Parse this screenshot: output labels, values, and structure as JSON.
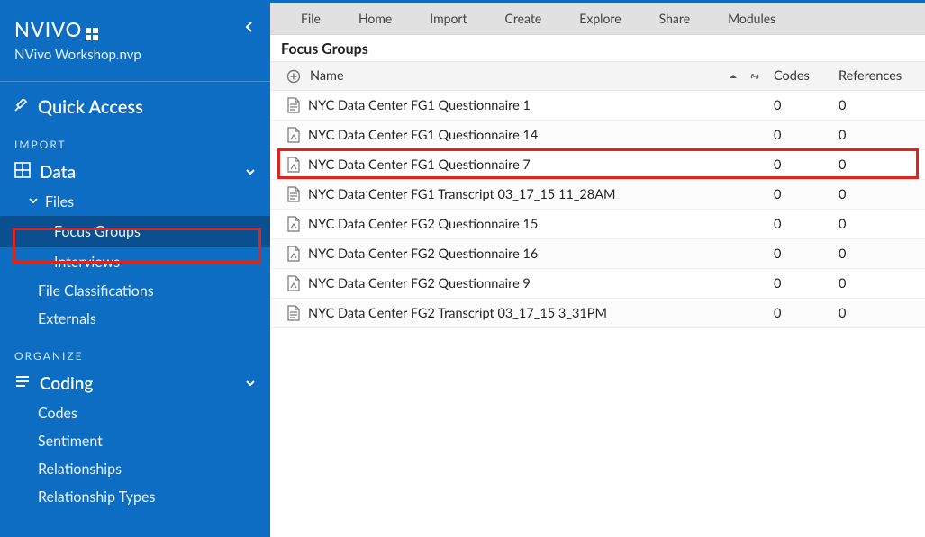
{
  "app": {
    "name": "NVIVO",
    "project_file": "NVivo Workshop.nvp"
  },
  "sidebar": {
    "quick_access": "Quick Access",
    "sections": {
      "import_label": "IMPORT",
      "organize_label": "ORGANIZE"
    },
    "data": {
      "label": "Data",
      "files": {
        "label": "Files"
      },
      "focus_groups": "Focus Groups",
      "interviews": "Interviews",
      "file_classifications": "File Classifications",
      "externals": "Externals"
    },
    "coding": {
      "label": "Coding",
      "codes": "Codes",
      "sentiment": "Sentiment",
      "relationships": "Relationships",
      "relationship_types": "Relationship Types"
    }
  },
  "ribbon": {
    "file": "File",
    "home": "Home",
    "import": "Import",
    "create": "Create",
    "explore": "Explore",
    "share": "Share",
    "modules": "Modules"
  },
  "panel": {
    "title": "Focus Groups",
    "columns": {
      "name": "Name",
      "codes": "Codes",
      "references": "References"
    },
    "rows": [
      {
        "icon": "doc",
        "name": "NYC Data Center FG1 Questionnaire 1",
        "codes": "0",
        "references": "0"
      },
      {
        "icon": "pdf",
        "name": "NYC Data Center FG1 Questionnaire 14",
        "codes": "0",
        "references": "0"
      },
      {
        "icon": "pdf",
        "name": "NYC Data Center FG1 Questionnaire 7",
        "codes": "0",
        "references": "0"
      },
      {
        "icon": "doc",
        "name": "NYC Data Center FG1 Transcript 03_17_15 11_28AM",
        "codes": "0",
        "references": "0"
      },
      {
        "icon": "pdf",
        "name": "NYC Data Center FG2 Questionnaire 15",
        "codes": "0",
        "references": "0"
      },
      {
        "icon": "pdf",
        "name": "NYC Data Center FG2 Questionnaire 16",
        "codes": "0",
        "references": "0"
      },
      {
        "icon": "pdf",
        "name": "NYC Data Center FG2 Questionnaire 9",
        "codes": "0",
        "references": "0"
      },
      {
        "icon": "doc",
        "name": "NYC Data Center FG2 Transcript 03_17_15 3_31PM",
        "codes": "0",
        "references": "0"
      }
    ]
  }
}
